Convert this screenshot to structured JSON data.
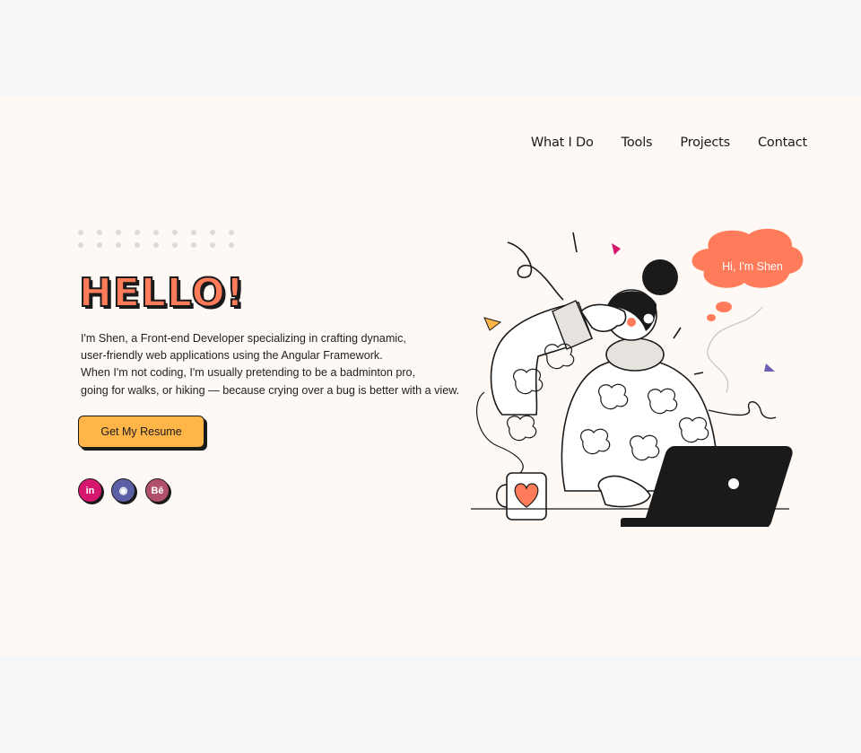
{
  "nav": {
    "items": [
      "What I Do",
      "Tools",
      "Projects",
      "Contact"
    ]
  },
  "hero": {
    "title": "HELLO!",
    "bio_lines": [
      "I'm Shen, a Front-end Developer specializing in crafting dynamic,",
      "user-friendly web applications using the Angular Framework.",
      "When I'm not coding, I'm usually pretending to be a badminton pro,",
      "going for walks, or hiking — because crying over a bug is better with a view."
    ],
    "resume_label": "Get My Resume",
    "speech_bubble": "Hi, I'm Shen"
  },
  "social": [
    {
      "name": "linkedin-icon",
      "glyph": "in",
      "color": "#d6176f"
    },
    {
      "name": "github-icon",
      "glyph": "◉",
      "color": "#5a5fa6"
    },
    {
      "name": "behance-icon",
      "glyph": "Bē",
      "color": "#b1506b"
    }
  ],
  "colors": {
    "accent": "#ff7b5a",
    "button": "#ffb547",
    "background": "#fff9f5",
    "outer": "#f6f7f8"
  }
}
